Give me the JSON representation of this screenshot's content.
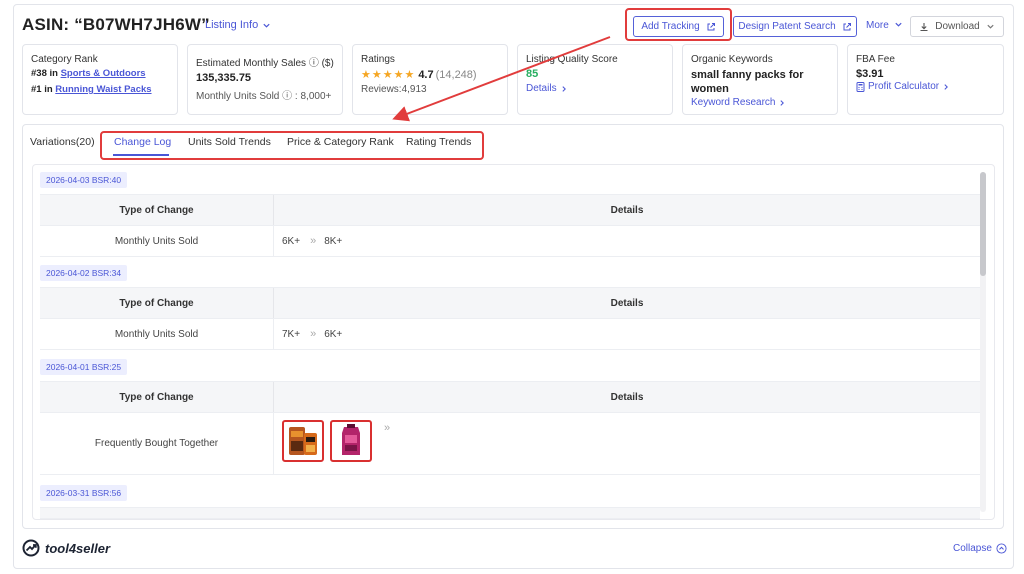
{
  "header": {
    "asin_title": "ASIN: “B07WH7JH6W”",
    "listing_info": "Listing Info",
    "add_tracking": "Add Tracking",
    "design_patent_search": "Design Patent Search",
    "more": "More",
    "download": "Download"
  },
  "cards": {
    "category_rank": {
      "label": "Category Rank",
      "rank1_prefix": "#38 in",
      "rank1_link": "Sports & Outdoors",
      "rank2_prefix": "#1 in",
      "rank2_link": "Running Waist Packs"
    },
    "sales": {
      "label": "Estimated Monthly Sales ⓘ ($)",
      "value": "135,335.75",
      "sub": "Monthly Units Sold ⓘ : 8,000+"
    },
    "ratings": {
      "label": "Ratings",
      "stars": "★★★★★",
      "score": "4.7",
      "count": "(14,248)",
      "reviews": "Reviews:4,913"
    },
    "quality": {
      "label": "Listing Quality Score",
      "score": "85",
      "details": "Details"
    },
    "keywords": {
      "label": "Organic Keywords",
      "value": "small fanny packs for women",
      "link": "Keyword Research"
    },
    "fba": {
      "label": "FBA Fee",
      "value": "$3.91",
      "link": "Profit Calculator"
    }
  },
  "tabs": {
    "variations": "Variations(20)",
    "change_log": "Change Log",
    "units_sold_trends": "Units Sold Trends",
    "price_category_rank": "Price & Category Rank",
    "rating_trends": "Rating Trends"
  },
  "log": {
    "col_type": "Type of Change",
    "col_details": "Details",
    "entries": [
      {
        "tag": "2026-04-03 BSR:40",
        "type": "Monthly Units Sold",
        "from": "6K+",
        "to": "8K+"
      },
      {
        "tag": "2026-04-02 BSR:34",
        "type": "Monthly Units Sold",
        "from": "7K+",
        "to": "6K+"
      },
      {
        "tag": "2026-04-01 BSR:25",
        "type": "Frequently Bought Together"
      },
      {
        "tag": "2026-03-31 BSR:56"
      }
    ]
  },
  "footer": {
    "brand": "tool4seller",
    "collapse": "Collapse"
  },
  "colors": {
    "accent": "#4a56d6",
    "highlight": "#e13c3c",
    "success": "#27ae60",
    "star": "#f5a623"
  }
}
